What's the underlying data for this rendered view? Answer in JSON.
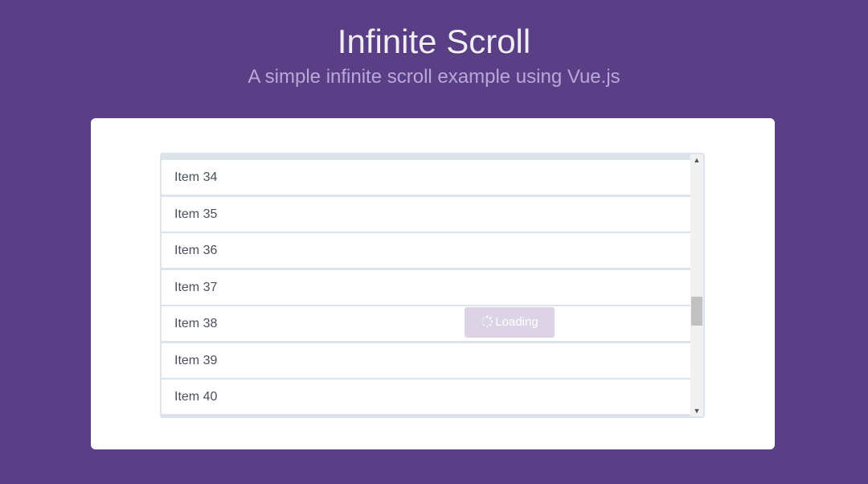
{
  "header": {
    "title": "Infinite Scroll",
    "subtitle": "A simple infinite scroll example using Vue.js"
  },
  "list": {
    "items": [
      {
        "label": "Item 34"
      },
      {
        "label": "Item 35"
      },
      {
        "label": "Item 36"
      },
      {
        "label": "Item 37"
      },
      {
        "label": "Item 38"
      },
      {
        "label": "Item 39"
      },
      {
        "label": "Item 40"
      }
    ]
  },
  "loading": {
    "label": "Loading",
    "icon": "spinner-icon"
  },
  "scrollbar": {
    "up_icon": "scroll-up-arrow-icon",
    "down_icon": "scroll-down-arrow-icon"
  },
  "colors": {
    "background": "#5a3f86",
    "card": "#ffffff",
    "row_divider": "#dde3ea",
    "loading_bg": "#dcd4e6",
    "subtitle": "#b9a8d8"
  }
}
